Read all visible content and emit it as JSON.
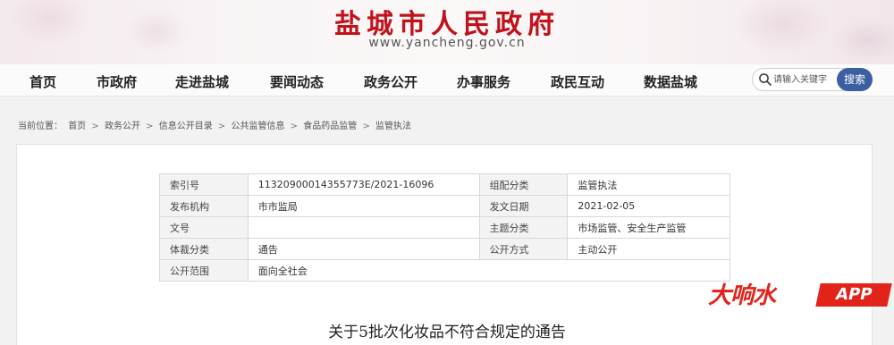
{
  "header": {
    "site_title": "盐城市人民政府",
    "site_url": "www.yancheng.gov.cn"
  },
  "nav": {
    "items": [
      "首页",
      "市政府",
      "走进盐城",
      "要闻动态",
      "政务公开",
      "办事服务",
      "政民互动",
      "数据盐城"
    ]
  },
  "search": {
    "placeholder": "请输入关键字",
    "button_label": "搜索"
  },
  "breadcrumb": {
    "label": "当前位置：",
    "items": [
      "首页",
      "政务公开",
      "信息公开目录",
      "公共监管信息",
      "食品药品监管",
      "监管执法"
    ],
    "separator": ">"
  },
  "meta": {
    "rows": [
      {
        "k1": "索引号",
        "v1": "11320900014355773E/2021-16096",
        "k2": "组配分类",
        "v2": "监管执法"
      },
      {
        "k1": "发布机构",
        "v1": "市市监局",
        "k2": "发文日期",
        "v2": "2021-02-05"
      },
      {
        "k1": "文号",
        "v1": "",
        "k2": "主题分类",
        "v2": "市场监管、安全生产监管"
      },
      {
        "k1": "体裁分类",
        "v1": "通告",
        "k2": "公开方式",
        "v2": "主动公开"
      },
      {
        "k1": "公开范围",
        "v1": "面向全社会"
      }
    ]
  },
  "document": {
    "title": "关于5批次化妆品不符合规定的通告"
  },
  "watermark": {
    "brand": "大响水",
    "app": "APP"
  },
  "colors": {
    "title_red": "#c1121c",
    "search_button": "#3c5fa3",
    "watermark_red": "#e2231a"
  }
}
